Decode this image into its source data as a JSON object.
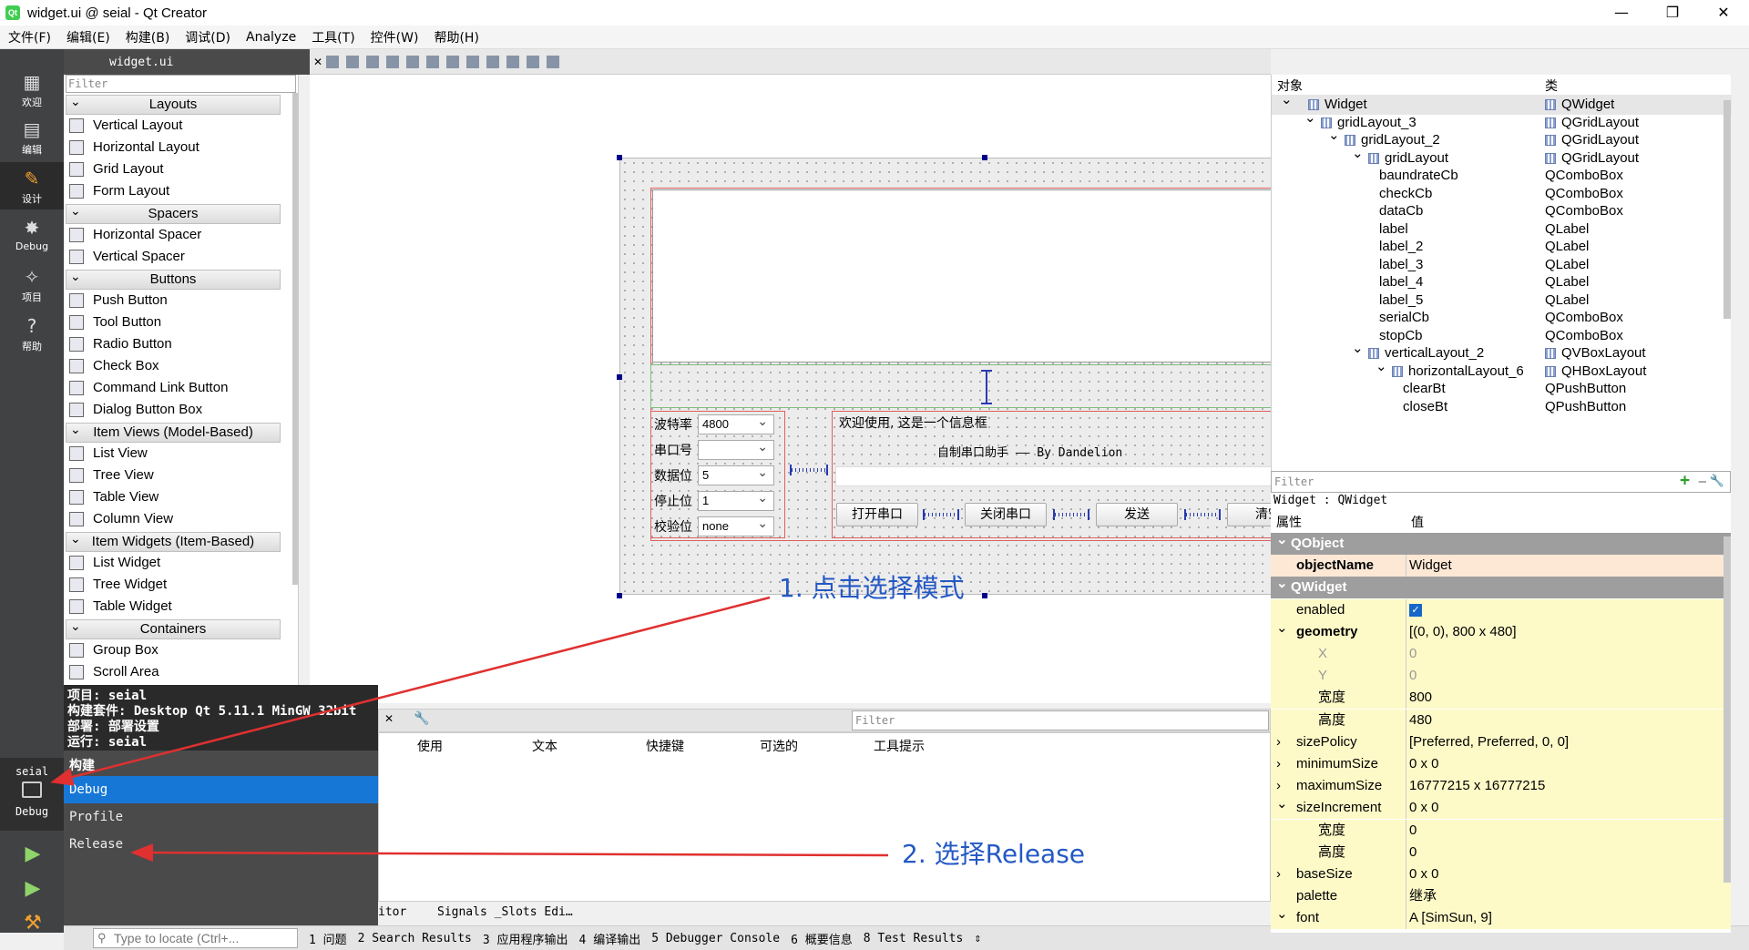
{
  "window": {
    "title": "widget.ui @ seial - Qt Creator",
    "minimize": "—",
    "maximize": "❐",
    "close": "✕"
  },
  "menu": [
    "文件(F)",
    "编辑(E)",
    "构建(B)",
    "调试(D)",
    "Analyze",
    "工具(T)",
    "控件(W)",
    "帮助(H)"
  ],
  "modes": [
    {
      "label": "欢迎",
      "icon": "▦"
    },
    {
      "label": "编辑",
      "icon": "▤"
    },
    {
      "label": "设计",
      "icon": "✎"
    },
    {
      "label": "Debug",
      "icon": "✸"
    },
    {
      "label": "项目",
      "icon": "✧"
    },
    {
      "label": "帮助",
      "icon": "?"
    }
  ],
  "editor": {
    "file_name": "widget.ui"
  },
  "widget_box": {
    "filter_placeholder": "Filter",
    "categories": [
      {
        "name": "Layouts",
        "items": [
          "Vertical Layout",
          "Horizontal Layout",
          "Grid Layout",
          "Form Layout"
        ]
      },
      {
        "name": "Spacers",
        "items": [
          "Horizontal Spacer",
          "Vertical Spacer"
        ]
      },
      {
        "name": "Buttons",
        "items": [
          "Push Button",
          "Tool Button",
          "Radio Button",
          "Check Box",
          "Command Link Button",
          "Dialog Button Box"
        ]
      },
      {
        "name": "Item Views (Model-Based)",
        "items": [
          "List View",
          "Tree View",
          "Table View",
          "Column View"
        ]
      },
      {
        "name": "Item Widgets (Item-Based)",
        "items": [
          "List Widget",
          "Tree Widget",
          "Table Widget"
        ]
      },
      {
        "name": "Containers",
        "items": [
          "Group Box",
          "Scroll Area"
        ]
      }
    ]
  },
  "form": {
    "labels": [
      "波特率",
      "串口号",
      "数据位",
      "停止位",
      "校验位"
    ],
    "combos": [
      "4800",
      "",
      "5",
      "1",
      "none"
    ],
    "info_line1": "欢迎使用, 这是一个信息框",
    "info_line2": "自制串口助手 —— By Dandelion",
    "buttons": [
      "打开串口",
      "关闭串口",
      "发送",
      "清空"
    ]
  },
  "run_panel": {
    "project_line": "项目: seial",
    "kit_line": "构建套件: Desktop Qt 5.11.1 MinGW 32bit",
    "deploy_line": "部署: 部署设置",
    "run_line": "运行: seial",
    "section": "构建",
    "configs": [
      "Debug",
      "Profile",
      "Release"
    ],
    "selected": "Debug",
    "target_name": "seial",
    "target_mode": "Debug"
  },
  "action_editor": {
    "filter_placeholder": "Filter",
    "columns": [
      "使用",
      "文本",
      "快捷键",
      "可选的",
      "工具提示"
    ],
    "tabs": [
      "itor",
      "Signals _Slots Edi…"
    ]
  },
  "status_bar": {
    "locate_placeholder": "Type to locate (Ctrl+...",
    "panes": [
      "1 问题",
      "2 Search Results",
      "3 应用程序输出",
      "4 编译输出",
      "5 Debugger Console",
      "6 概要信息",
      "8 Test Results"
    ]
  },
  "object_inspector": {
    "col_object": "对象",
    "col_class": "类",
    "rows": [
      {
        "name": "Widget",
        "cls": "QWidget",
        "level": 0,
        "exp": "⌄"
      },
      {
        "name": "gridLayout_3",
        "cls": "QGridLayout",
        "level": 1,
        "exp": "⌄"
      },
      {
        "name": "gridLayout_2",
        "cls": "QGridLayout",
        "level": 2,
        "exp": "⌄"
      },
      {
        "name": "gridLayout",
        "cls": "QGridLayout",
        "level": 3,
        "exp": "⌄"
      },
      {
        "name": "baundrateCb",
        "cls": "QComboBox",
        "level": 4,
        "exp": ""
      },
      {
        "name": "checkCb",
        "cls": "QComboBox",
        "level": 4,
        "exp": ""
      },
      {
        "name": "dataCb",
        "cls": "QComboBox",
        "level": 4,
        "exp": ""
      },
      {
        "name": "label",
        "cls": "QLabel",
        "level": 4,
        "exp": ""
      },
      {
        "name": "label_2",
        "cls": "QLabel",
        "level": 4,
        "exp": ""
      },
      {
        "name": "label_3",
        "cls": "QLabel",
        "level": 4,
        "exp": ""
      },
      {
        "name": "label_4",
        "cls": "QLabel",
        "level": 4,
        "exp": ""
      },
      {
        "name": "label_5",
        "cls": "QLabel",
        "level": 4,
        "exp": ""
      },
      {
        "name": "serialCb",
        "cls": "QComboBox",
        "level": 4,
        "exp": ""
      },
      {
        "name": "stopCb",
        "cls": "QComboBox",
        "level": 4,
        "exp": ""
      },
      {
        "name": "verticalLayout_2",
        "cls": "QVBoxLayout",
        "level": 3,
        "exp": "⌄"
      },
      {
        "name": "horizontalLayout_6",
        "cls": "QHBoxLayout",
        "level": 4,
        "exp": "⌄"
      },
      {
        "name": "clearBt",
        "cls": "QPushButton",
        "level": 5,
        "exp": ""
      },
      {
        "name": "closeBt",
        "cls": "QPushButton",
        "level": 5,
        "exp": ""
      }
    ],
    "filter_placeholder": "Filter",
    "add": "+",
    "remove": "—",
    "tool": "🔧"
  },
  "property_editor": {
    "context": "Widget : QWidget",
    "col_prop": "属性",
    "col_value": "值",
    "rows": [
      {
        "name": "QObject",
        "value": "",
        "kind": "grp"
      },
      {
        "name": "objectName",
        "value": "Widget",
        "kind": "o",
        "bold": true
      },
      {
        "name": "QWidget",
        "value": "",
        "kind": "grp"
      },
      {
        "name": "enabled",
        "value": "✓",
        "kind": "y"
      },
      {
        "name": "geometry",
        "value": "[(0, 0), 800 x 480]",
        "kind": "y",
        "bold": true,
        "exp": "⌄"
      },
      {
        "name": "X",
        "value": "0",
        "kind": "y",
        "sub": true,
        "dim": true
      },
      {
        "name": "Y",
        "value": "0",
        "kind": "y",
        "sub": true,
        "dim": true
      },
      {
        "name": "宽度",
        "value": "800",
        "kind": "y",
        "sub": true
      },
      {
        "name": "高度",
        "value": "480",
        "kind": "y",
        "sub": true
      },
      {
        "name": "sizePolicy",
        "value": "[Preferred, Preferred, 0, 0]",
        "kind": "y",
        "exp": "›"
      },
      {
        "name": "minimumSize",
        "value": "0 x 0",
        "kind": "y",
        "exp": "›"
      },
      {
        "name": "maximumSize",
        "value": "16777215 x 16777215",
        "kind": "y",
        "exp": "›"
      },
      {
        "name": "sizeIncrement",
        "value": "0 x 0",
        "kind": "y",
        "exp": "⌄"
      },
      {
        "name": "宽度",
        "value": "0",
        "kind": "y",
        "sub": true
      },
      {
        "name": "高度",
        "value": "0",
        "kind": "y",
        "sub": true
      },
      {
        "name": "baseSize",
        "value": "0 x 0",
        "kind": "y",
        "exp": "›"
      },
      {
        "name": "palette",
        "value": "继承",
        "kind": "y"
      },
      {
        "name": "font",
        "value": "A  [SimSun, 9]",
        "kind": "y",
        "exp": "⌄"
      }
    ]
  },
  "annotations": {
    "step1": "1. 点击选择模式",
    "step2": "2. 选择Release"
  },
  "colors": {
    "annotation": "#2458c4",
    "arrow": "#e03030",
    "selection": "#1777d6"
  }
}
